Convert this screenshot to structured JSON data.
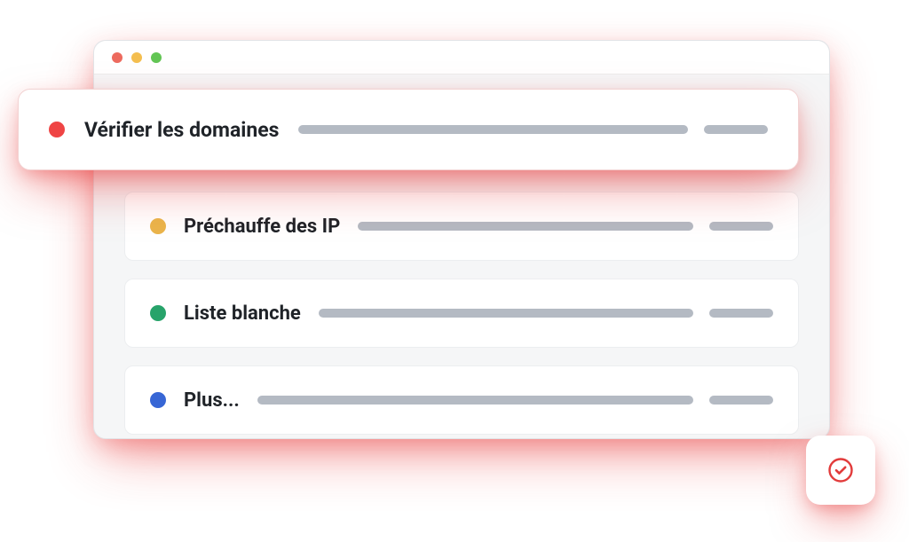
{
  "highlight": {
    "label": "Vérifier les domaines",
    "color": "#ef4444"
  },
  "rows": [
    {
      "label": "Préchauffe des IP",
      "dot_class": "dot-amber"
    },
    {
      "label": "Liste blanche",
      "dot_class": "dot-green"
    },
    {
      "label": "Plus...",
      "dot_class": "dot-blue"
    }
  ],
  "badge": {
    "icon": "check-circle"
  }
}
